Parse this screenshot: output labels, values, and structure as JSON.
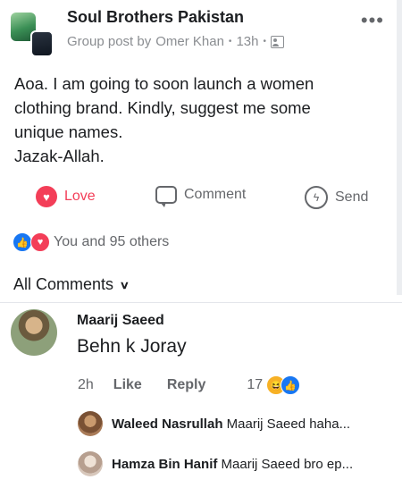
{
  "post": {
    "group_name": "Soul Brothers Pakistan",
    "meta_prefix": "Group post by",
    "author": "Omer Khan",
    "time": "13h",
    "more_icon": "more-horizontal-icon",
    "text_lines": [
      "Aoa. I am going to soon launch a women",
      "clothing brand. Kindly, suggest me some",
      "unique names.",
      "Jazak-Allah."
    ]
  },
  "actions": {
    "love_label": "Love",
    "comment_label": "Comment",
    "send_label": "Send"
  },
  "reactions": {
    "summary": "You and 95 others"
  },
  "comments": {
    "header": "All Comments",
    "main": {
      "name": "Maarij Saeed",
      "text": "Behn k Joray",
      "time": "2h",
      "like_label": "Like",
      "reply_label": "Reply",
      "reaction_count": "17"
    },
    "replies": [
      {
        "name": "Waleed Nasrullah",
        "text": "Maarij Saeed haha..."
      },
      {
        "name": "Hamza Bin Hanif",
        "text": "Maarij Saeed bro ep..."
      }
    ]
  },
  "colors": {
    "love": "#f33e58",
    "like": "#1877f2",
    "muted": "#65676b",
    "text": "#1c1e21"
  }
}
